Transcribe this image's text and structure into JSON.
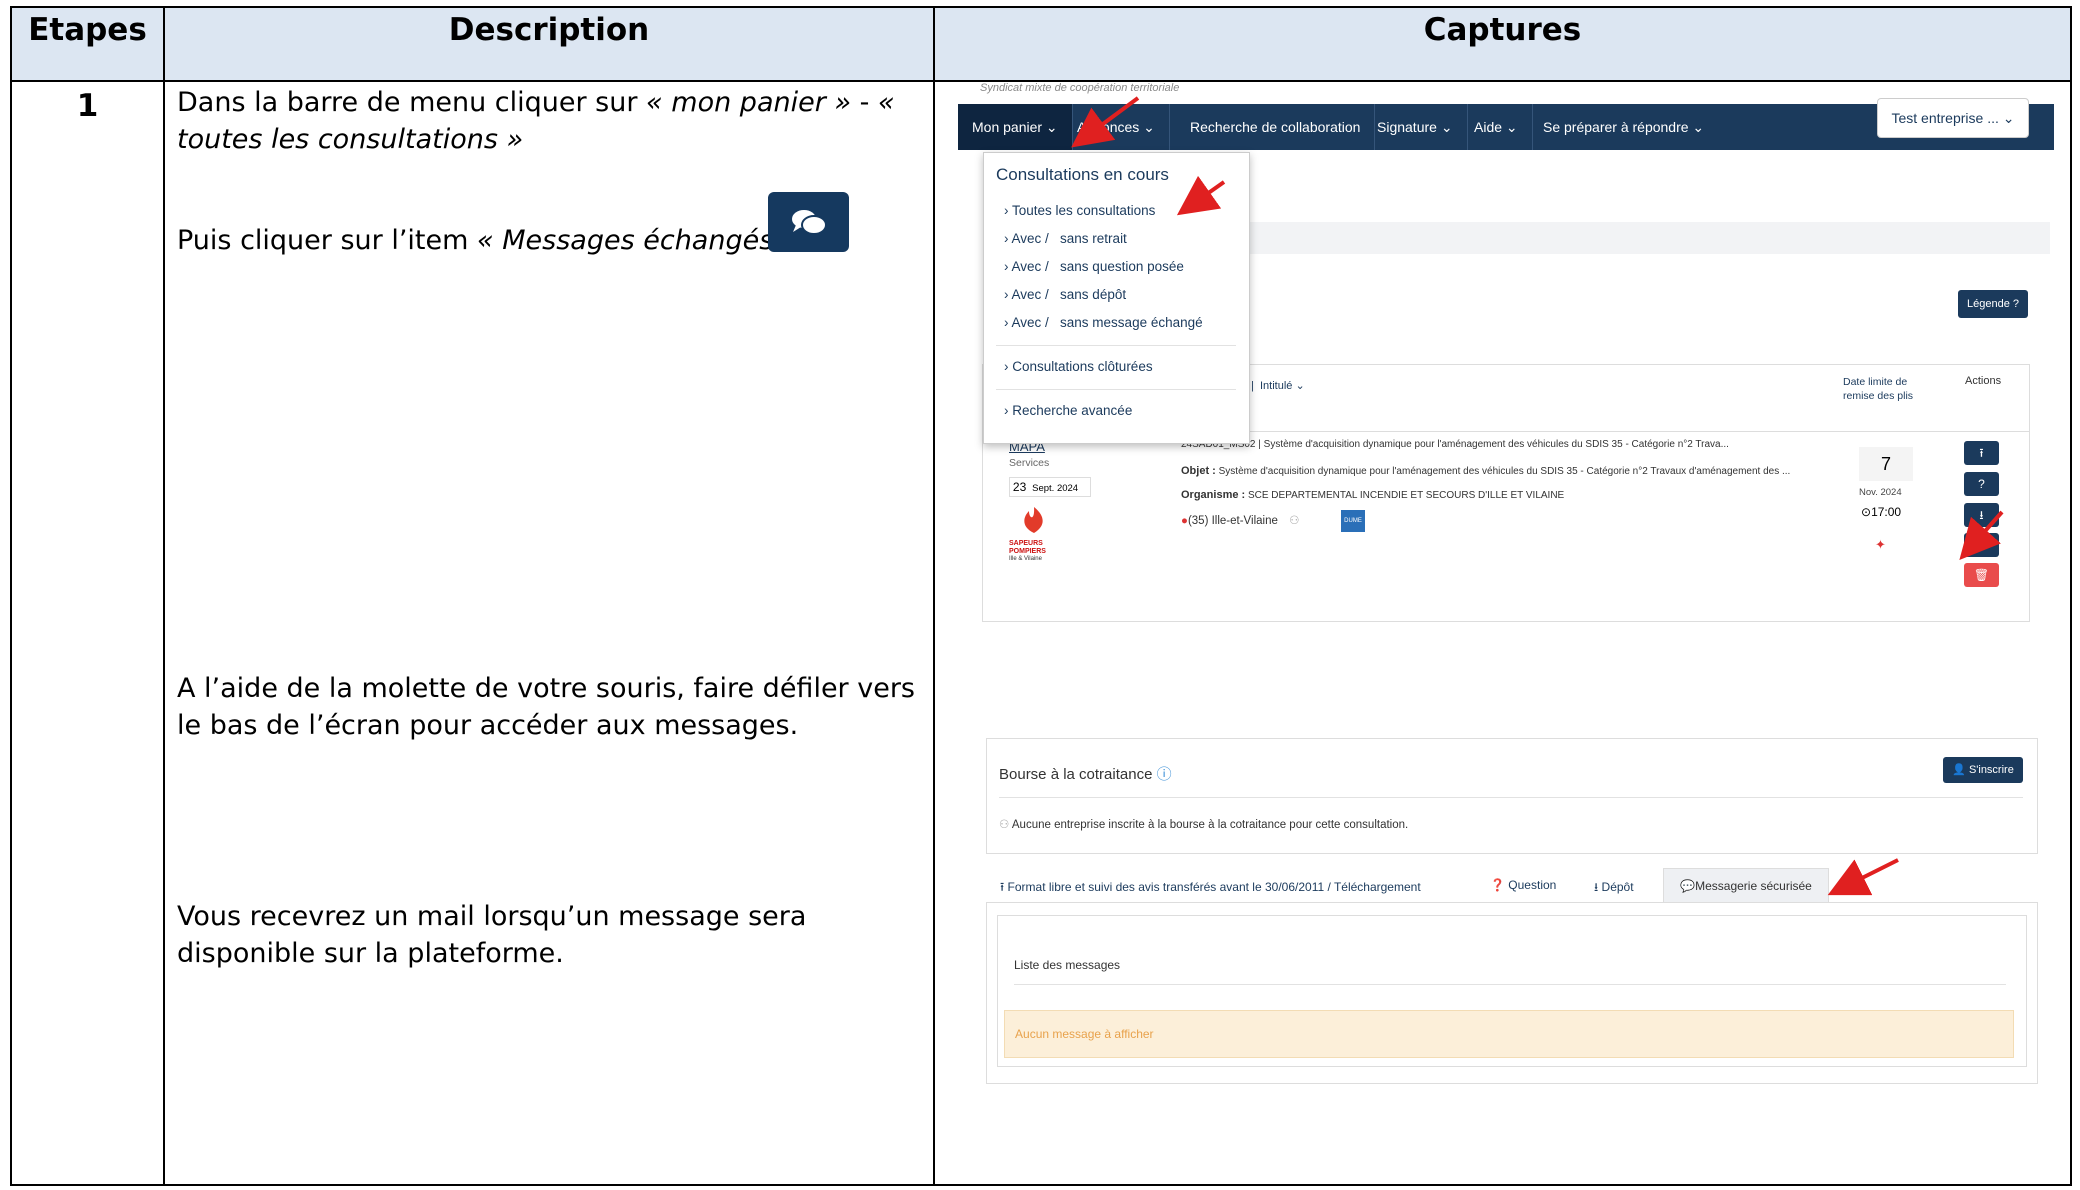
{
  "headers": {
    "etapes": "Etapes",
    "description": "Description",
    "captures": "Captures"
  },
  "step_number": "1",
  "description": {
    "p1_a": "Dans la barre de menu cliquer sur ",
    "p1_b": "« mon panier »",
    "p1_c": " - ",
    "p1_d": "« toutes les consultations »",
    "p2_a": "Puis cliquer sur l’item ",
    "p2_b": "« Messages échangés » :",
    "p3": "A l’aide de la molette de votre souris, faire défiler vers le bas de l’écran pour accéder aux messages.",
    "p4": "Vous recevrez un mail lorsqu’un message sera disponible sur la plateforme."
  },
  "capture": {
    "syndicat": "Syndicat mixte de coopération territoriale",
    "nav": [
      "Mon panier",
      "Annonces",
      "Recherche de collaboration",
      "Signature",
      "Aide",
      "Se préparer à répondre"
    ],
    "entreprise": "Test entreprise ...",
    "dropdown": {
      "title": "Consultations en cours",
      "items": [
        "Toutes les consultations",
        "Avec /   sans retrait",
        "Avec /   sans question posée",
        "Avec /   sans dépôt",
        "Avec /   sans message échangé"
      ],
      "closed": "Consultations clôturées",
      "advanced": "Recherche avancée"
    },
    "legende": "Légende ?",
    "columns": {
      "intitule": "Intitulé",
      "date_limite": "Date limite de remise des plis",
      "actions": "Actions"
    },
    "row": {
      "procedure": "MAPA",
      "category": "Services",
      "pub_day": "23",
      "pub_month": "Sept. 2024",
      "ref_line": "24SAD01_MS02  |  Système d'acquisition dynamique pour l'aménagement des véhicules du SDIS 35 - Catégorie n°2 Trava...",
      "objet_label": "Objet :",
      "objet": "Système d'acquisition dynamique pour l'aménagement des véhicules du SDIS 35 - Catégorie n°2 Travaux d'aménagement des ...",
      "organisme_label": "Organisme :",
      "organisme": "SCE DEPARTEMENTAL INCENDIE ET SECOURS D'ILLE ET VILAINE",
      "location": "(35) Ille-et-Vilaine",
      "dume": "DUME",
      "logo_text_1": "SAPEURS",
      "logo_text_2": "POMPIERS",
      "logo_text_3": "Ille & Vilaine",
      "deadline_day": "7",
      "deadline_month": "Nov.  2024",
      "deadline_time": "17:00"
    },
    "bourse": {
      "title": "Bourse à la cotraitance",
      "inscrire": "S'inscrire",
      "empty": "Aucune entreprise inscrite à la bourse à la cotraitance pour cette consultation."
    },
    "tabs": {
      "format": "Format libre et suivi des avis transférés avant le 30/06/2011 / Téléchargement",
      "question": "Question",
      "depot": "Dépôt",
      "messagerie": "Messagerie sécurisée"
    },
    "messages": {
      "list_title": "Liste des messages",
      "empty": "Aucun message à afficher"
    }
  },
  "colors": {
    "header_bg": "#dce6f2",
    "nav_bg": "#1b3a5c",
    "arrow": "#e02020",
    "warning_bg": "#fcefd9",
    "warning_text": "#e8a24c"
  }
}
